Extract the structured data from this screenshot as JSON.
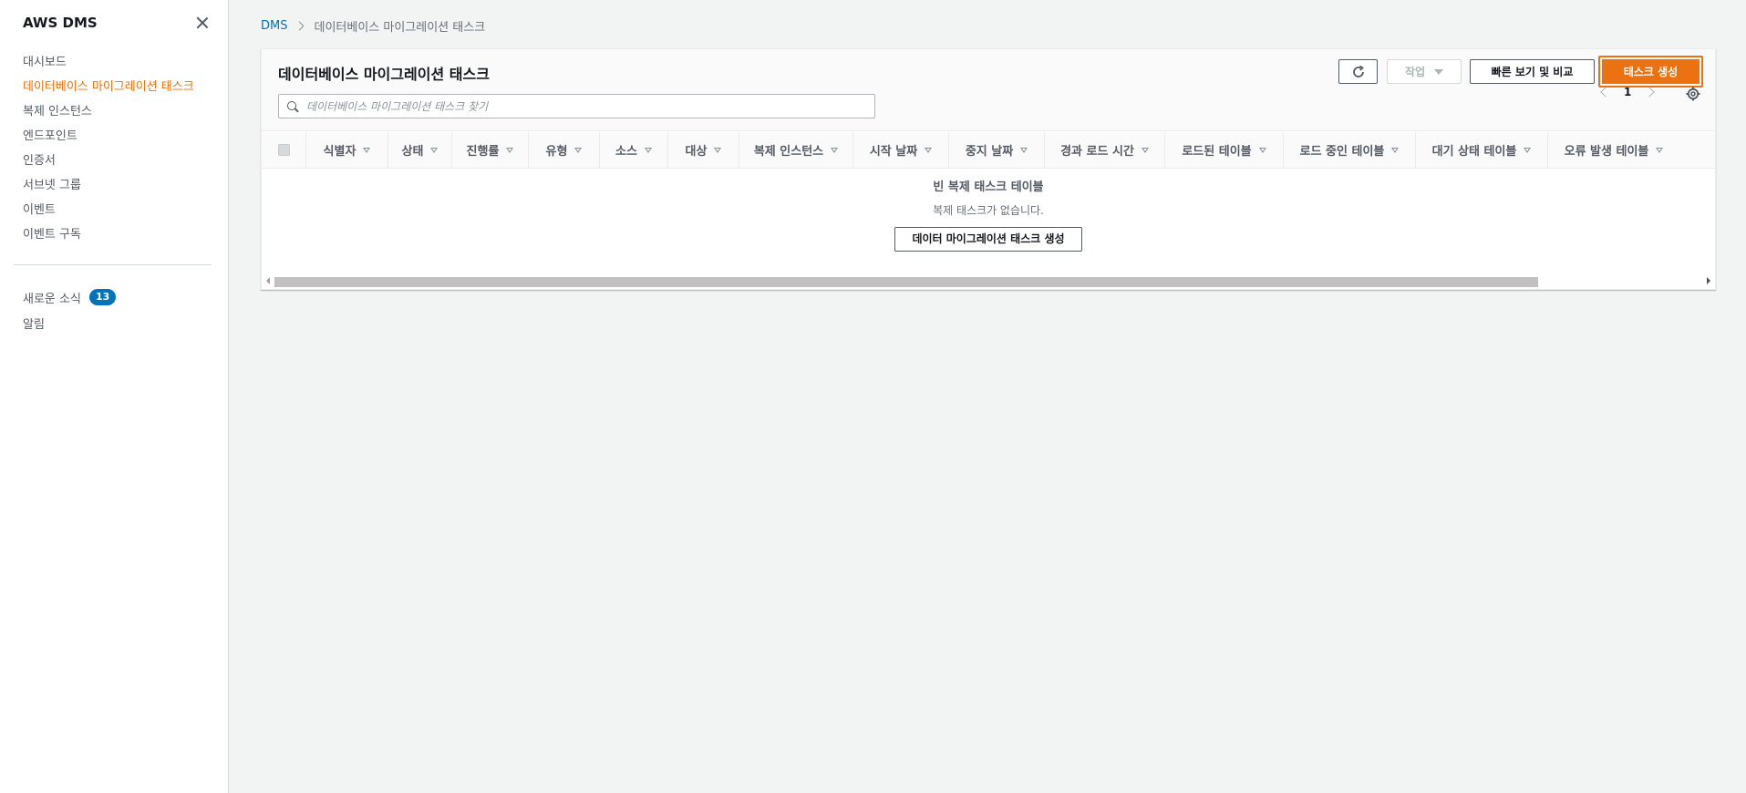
{
  "sidebar": {
    "title": "AWS DMS",
    "items": [
      {
        "label": "대시보드"
      },
      {
        "label": "데이터베이스 마이그레이션 태스크"
      },
      {
        "label": "복제 인스턴스"
      },
      {
        "label": "엔드포인트"
      },
      {
        "label": "인증서"
      },
      {
        "label": "서브넷 그룹"
      },
      {
        "label": "이벤트"
      },
      {
        "label": "이벤트 구독"
      }
    ],
    "active_item": "데이터베이스 마이그레이션 태스크",
    "footer_items": [
      {
        "label": "새로운 소식",
        "badge": "13"
      },
      {
        "label": "알림"
      }
    ]
  },
  "breadcrumb": {
    "root": "DMS",
    "current": "데이터베이스 마이그레이션 태스크"
  },
  "panel": {
    "title": "데이터베이스 마이그레이션 태스크",
    "search_placeholder": "데이터베이스 마이그레이션 태스크 찾기",
    "actions_label": "작업",
    "compare_label": "빠른 보기 및 비교",
    "create_label": "태스크 생성",
    "page": "1"
  },
  "table": {
    "columns": [
      "식별자",
      "상태",
      "진행률",
      "유형",
      "소스",
      "대상",
      "복제 인스턴스",
      "시작 날짜",
      "중지 날짜",
      "경과 로드 시간",
      "로드된 테이블",
      "로드 중인 테이블",
      "대기 상태 테이블",
      "오류 발생 테이블"
    ],
    "empty_title": "빈 복제 태스크 테이블",
    "empty_desc": "복제 태스크가 없습니다.",
    "empty_button": "데이터 마이그레이션 태스크 생성"
  },
  "colors": {
    "accent": "#ec7211",
    "link": "#0073bb",
    "badge": "#0073bb"
  }
}
